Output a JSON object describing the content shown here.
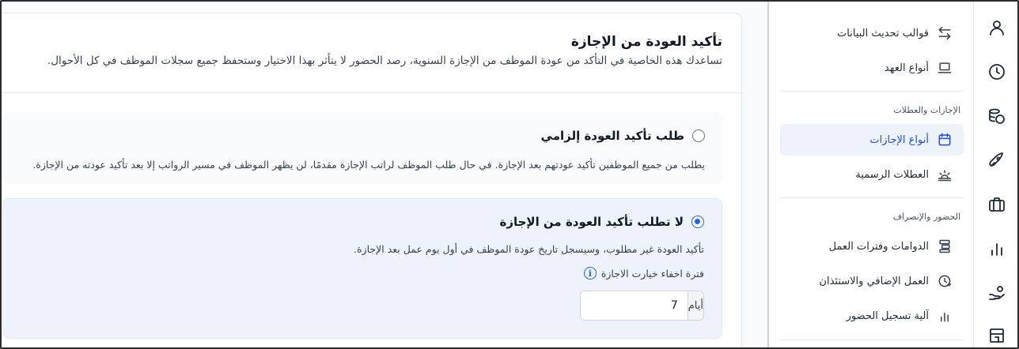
{
  "card": {
    "title": "تأكيد العودة من الإجازة",
    "description": "تساعدك هذه الخاصية في التأكد من عودة الموظف من الإجازة السنوية، رصد الحضور لا يتأثر بهذا الاختيار وستحفظ جميع سجلات الموظف في كل الأحوال."
  },
  "options": [
    {
      "title": "طلب تأكيد العودة إلزامي",
      "description": "يطلب من جميع الموظفين تأكيد عودتهم بعد الإجازة. في حال طلب الموظف لراتب الإجازة مقدمًا، لن يظهر الموظف في مسير الرواتب إلا بعد تأكيد عودته من الإجازة.",
      "selected": false
    },
    {
      "title": "لا تطلب تأكيد العودة من الإجازة",
      "description": "تأكيد العودة غير مطلوب، وسيسجل تاريخ عودة الموظف في أول يوم عمل بعد الإجازة.",
      "selected": true,
      "hide_period_label": "فترة اخفاء خيارت الاجازة",
      "hide_period_value": "7",
      "hide_period_unit": "أيام"
    }
  ],
  "sidebar": {
    "top_items": [
      {
        "label": "قوالب تحديث البيانات",
        "icon": "arrows-exchange-icon"
      },
      {
        "label": "أنواع العهد",
        "icon": "laptop-icon"
      }
    ],
    "leave_section": "الإجازات والعطلات",
    "leave_items": [
      {
        "label": "أنواع الإجازات",
        "icon": "calendar-icon",
        "active": true
      },
      {
        "label": "العطلات الرسمية",
        "icon": "sunrise-icon"
      }
    ],
    "attendance_section": "الحضور والإنصراف",
    "attendance_items": [
      {
        "label": "الدوامات وفترات العمل",
        "icon": "shifts-icon"
      },
      {
        "label": "العمل الإضافي والاستئذان",
        "icon": "clock-plus-icon"
      },
      {
        "label": "آلية تسجيل الحضور",
        "icon": "bars-icon"
      }
    ]
  },
  "rail": [
    "user-icon",
    "clock-icon",
    "coins-icon",
    "rocket-icon",
    "briefcase-icon",
    "chart-icon",
    "hand-coin-icon",
    "store-icon"
  ],
  "colors": {
    "accent": "#2563eb",
    "active_bg": "#eef2fb"
  }
}
